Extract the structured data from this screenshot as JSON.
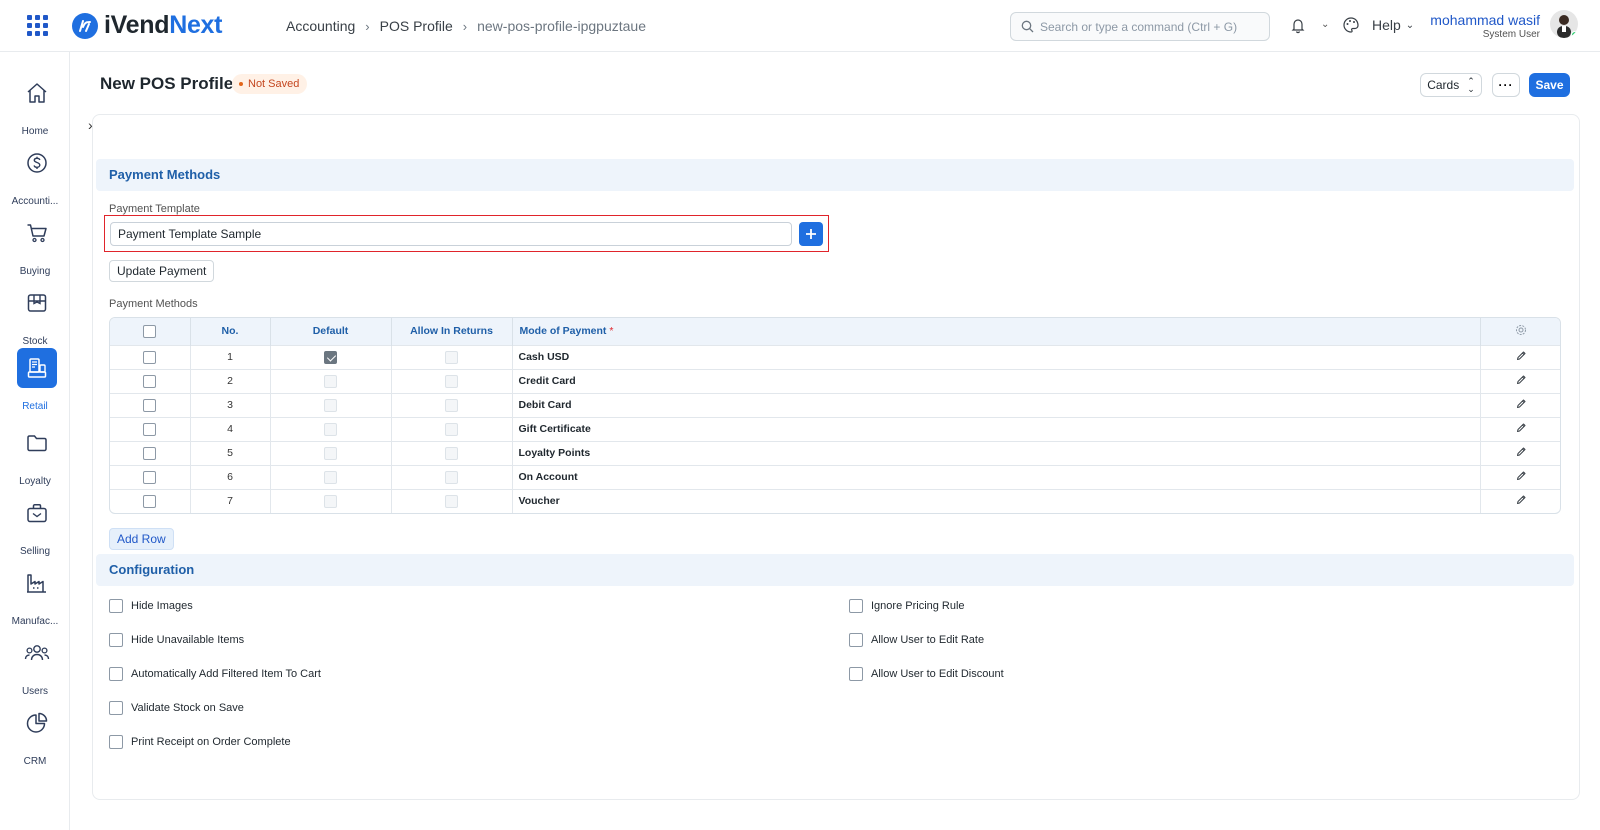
{
  "app": {
    "brand_prefix": "i",
    "brand_main": "Vend",
    "brand_suffix": "Next"
  },
  "breadcrumb": [
    "Accounting",
    "POS Profile",
    "new-pos-profile-ipgpuztaue"
  ],
  "search": {
    "placeholder": "Search or type a command (Ctrl + G)"
  },
  "topbar": {
    "help_label": "Help"
  },
  "user": {
    "name": "mohammad wasif",
    "role": "System User"
  },
  "sidebar": {
    "items": [
      {
        "label": "Home",
        "icon": "home-icon"
      },
      {
        "label": "Accounti...",
        "icon": "dollar-icon"
      },
      {
        "label": "Buying",
        "icon": "cart-icon"
      },
      {
        "label": "Stock",
        "icon": "box-icon"
      },
      {
        "label": "Retail",
        "icon": "pos-icon",
        "active": true
      },
      {
        "label": "Loyalty",
        "icon": "folder-icon"
      },
      {
        "label": "Selling",
        "icon": "briefcase-icon"
      },
      {
        "label": "Manufac...",
        "icon": "factory-icon"
      },
      {
        "label": "Users",
        "icon": "users-icon"
      },
      {
        "label": "CRM",
        "icon": "pie-icon"
      }
    ]
  },
  "page": {
    "title": "New POS Profile",
    "status": "Not Saved"
  },
  "actions": {
    "view_label": "Cards",
    "more_label": "···",
    "save_label": "Save"
  },
  "payment_section": {
    "title": "Payment Methods",
    "template_label": "Payment Template",
    "template_value": "Payment Template Sample",
    "update_button": "Update Payment",
    "table_label": "Payment Methods",
    "columns": {
      "no": "No.",
      "default": "Default",
      "allow_returns": "Allow In Returns",
      "mode": "Mode of Payment",
      "required_mark": "*"
    },
    "rows": [
      {
        "no": "1",
        "default": true,
        "mode": "Cash USD"
      },
      {
        "no": "2",
        "default": false,
        "mode": "Credit Card"
      },
      {
        "no": "3",
        "default": false,
        "mode": "Debit Card"
      },
      {
        "no": "4",
        "default": false,
        "mode": "Gift Certificate"
      },
      {
        "no": "5",
        "default": false,
        "mode": "Loyalty Points"
      },
      {
        "no": "6",
        "default": false,
        "mode": "On Account"
      },
      {
        "no": "7",
        "default": false,
        "mode": "Voucher"
      }
    ],
    "add_row": "Add Row"
  },
  "configuration": {
    "title": "Configuration",
    "left": [
      "Hide Images",
      "Hide Unavailable Items",
      "Automatically Add Filtered Item To Cart",
      "Validate Stock on Save",
      "Print Receipt on Order Complete"
    ],
    "right": [
      "Ignore Pricing Rule",
      "Allow User to Edit Rate",
      "Allow User to Edit Discount"
    ]
  },
  "colors": {
    "primary": "#1f6fe0",
    "section_bg": "#eef4fb",
    "section_text": "#1f5fa8",
    "status_text": "#c4461f",
    "highlight": "#e0242b"
  }
}
